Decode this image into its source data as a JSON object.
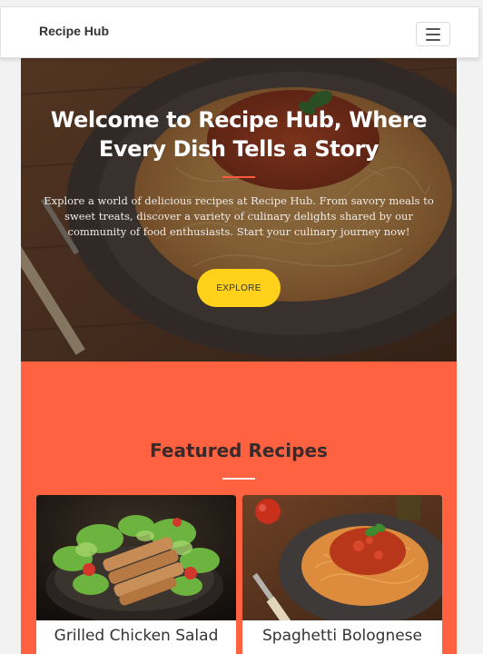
{
  "navbar": {
    "brand": "Recipe Hub",
    "menu_icon": "hamburger-menu-icon"
  },
  "hero": {
    "title": "Welcome to Recipe Hub, Where Every Dish Tells a Story",
    "description": "Explore a world of delicious recipes at Recipe Hub. From savory meals to sweet treats, discover a variety of culinary delights shared by our community of food enthusiasts. Start your culinary journey now!",
    "button_label": "EXPLORE"
  },
  "featured": {
    "title": "Featured Recipes",
    "cards": [
      {
        "title": "Grilled Chicken Salad"
      },
      {
        "title": "Spaghetti Bolognese"
      }
    ]
  },
  "colors": {
    "accent": "#fe6241",
    "button": "#ffd11a",
    "hero_divider": "#ff5a3c"
  }
}
